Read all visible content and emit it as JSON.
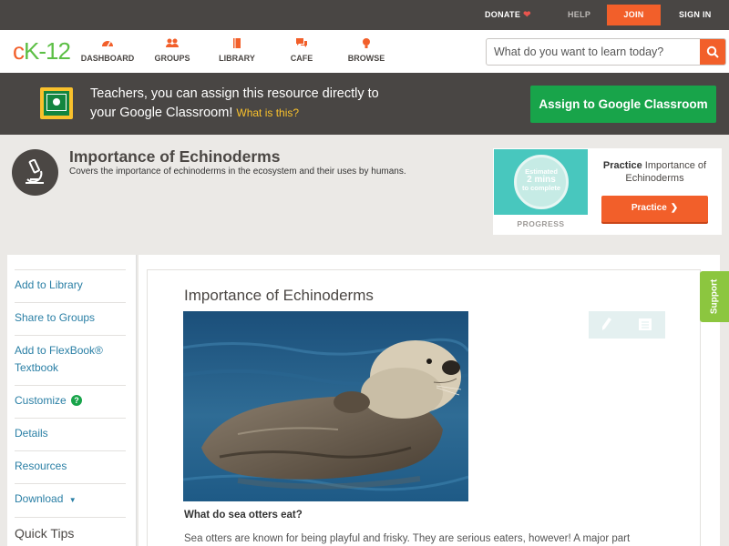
{
  "topbar": {
    "donate": "DONATE",
    "help": "HELP",
    "join": "JOIN",
    "signin": "SIGN IN"
  },
  "nav": {
    "logo": {
      "c": "c",
      "k": "K",
      "n": "-12"
    },
    "items": [
      {
        "label": "DASHBOARD",
        "icon": "dashboard-icon"
      },
      {
        "label": "GROUPS",
        "icon": "groups-icon"
      },
      {
        "label": "LIBRARY",
        "icon": "library-icon"
      },
      {
        "label": "CAFE",
        "icon": "cafe-icon"
      },
      {
        "label": "BROWSE",
        "icon": "browse-icon"
      }
    ],
    "search_placeholder": "What do you want to learn today?"
  },
  "classroom": {
    "line1": "Teachers, you can assign this resource directly to",
    "line2": "your Google Classroom!",
    "what": "What is this?",
    "button": "Assign to Google Classroom"
  },
  "header": {
    "title": "Importance of Echinoderms",
    "subtitle": "Covers the importance of echinoderms in the ecosystem and their uses by humans."
  },
  "practice": {
    "estimated": "Estimated",
    "mins": "2 mins",
    "to_complete": "to complete",
    "progress": "PROGRESS",
    "title_bold": "Practice",
    "title_rest": "Importance of Echinoderms",
    "button": "Practice"
  },
  "sidebar": {
    "items": [
      "Add to Library",
      "Share to Groups",
      "Add to FlexBook® Textbook",
      "Customize",
      "Details",
      "Resources",
      "Download"
    ],
    "tips": "Quick Tips"
  },
  "content": {
    "title": "Importance of Echinoderms",
    "question": "What do sea otters eat?",
    "paragraph": "Sea otters are known for being playful and frisky. They are serious eaters, however! A major part"
  },
  "support": "Support",
  "colors": {
    "brand_orange": "#f25f2a",
    "classroom_green": "#18a44a",
    "link_blue": "#2a7fa5"
  }
}
